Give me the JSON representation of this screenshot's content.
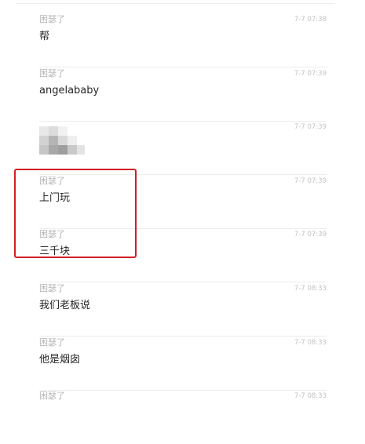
{
  "messages": [
    {
      "sender": "困瑟了",
      "time": "7-7 07:38",
      "text": "帮"
    },
    {
      "sender": "困瑟了",
      "time": "7-7 07:39",
      "text": "angelababy"
    },
    {
      "sender": "",
      "time": "7-7 07:39",
      "text": ""
    },
    {
      "sender": "困瑟了",
      "time": "7-7 07:39",
      "text": "上门玩"
    },
    {
      "sender": "困瑟了",
      "time": "7-7 07:39",
      "text": "三千块"
    },
    {
      "sender": "困瑟了",
      "time": "7-7 08:33",
      "text": "我们老板说"
    },
    {
      "sender": "困瑟了",
      "time": "7-7 08:33",
      "text": "他是烟囱"
    },
    {
      "sender": "困瑟了",
      "time": "7-7 08:33",
      "text": ""
    }
  ],
  "colors": {
    "highlight": "#d21f25",
    "sender": "#b5b5b5",
    "time": "#c2c2c2",
    "text": "#262626",
    "divider": "#ececec"
  }
}
